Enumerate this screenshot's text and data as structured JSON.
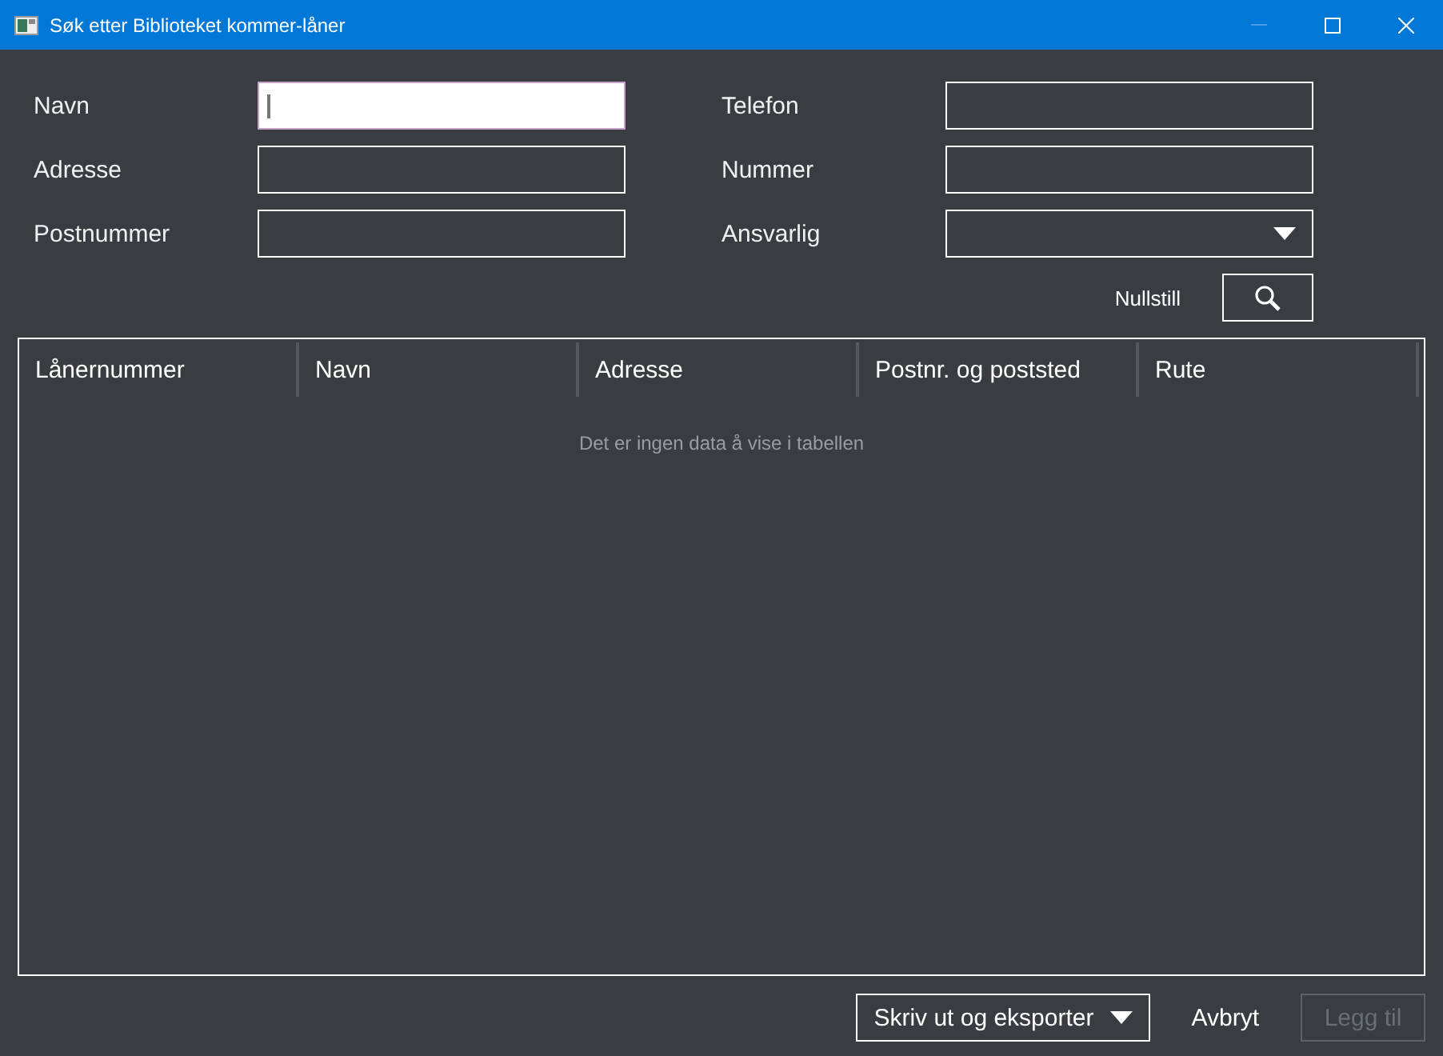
{
  "window": {
    "title": "Søk etter Biblioteket kommer-låner"
  },
  "form": {
    "fields": [
      {
        "label": "Navn",
        "kind": "text",
        "focused": true
      },
      {
        "label": "Telefon",
        "kind": "text",
        "focused": false
      },
      {
        "label": "Adresse",
        "kind": "text",
        "focused": false
      },
      {
        "label": "Nummer",
        "kind": "text",
        "focused": false
      },
      {
        "label": "Postnummer",
        "kind": "text",
        "focused": false
      },
      {
        "label": "Ansvarlig",
        "kind": "dropdown",
        "focused": false
      }
    ],
    "reset_button": "Nullstill"
  },
  "table": {
    "columns": [
      "Lånernummer",
      "Navn",
      "Adresse",
      "Postnr. og poststed",
      "Rute"
    ],
    "empty_message": "Det er ingen data å vise i tabellen"
  },
  "footer": {
    "buttons": [
      {
        "label": "Skriv ut og eksporter",
        "kind": "dropdown",
        "disabled": false
      },
      {
        "label": "Avbryt",
        "kind": "text",
        "disabled": false
      },
      {
        "label": "Legg til",
        "kind": "outlined",
        "disabled": true
      }
    ]
  }
}
